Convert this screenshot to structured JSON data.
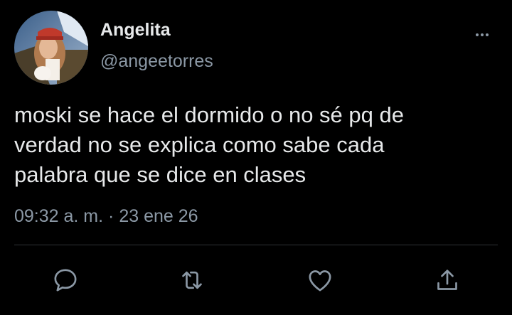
{
  "author": {
    "display_name": "Angelita",
    "handle": "@angeetorres",
    "avatar_icon": "profile-photo"
  },
  "tweet": {
    "text": "moski se hace el dormido o no sé pq de\nverdad no se explica como sabe cada\npalabra que se dice en clases",
    "time": "09:32 a. m.",
    "separator": "·",
    "date": "23 ene 26"
  },
  "actions": [
    {
      "name": "reply",
      "icon": "speech-bubble-icon"
    },
    {
      "name": "retweet",
      "icon": "retweet-icon"
    },
    {
      "name": "like",
      "icon": "heart-icon"
    },
    {
      "name": "share",
      "icon": "share-icon"
    }
  ],
  "colors": {
    "background": "#000000",
    "primary_text": "#e7e9ea",
    "secondary_text": "#8b98a5",
    "divider": "#2f3336"
  }
}
